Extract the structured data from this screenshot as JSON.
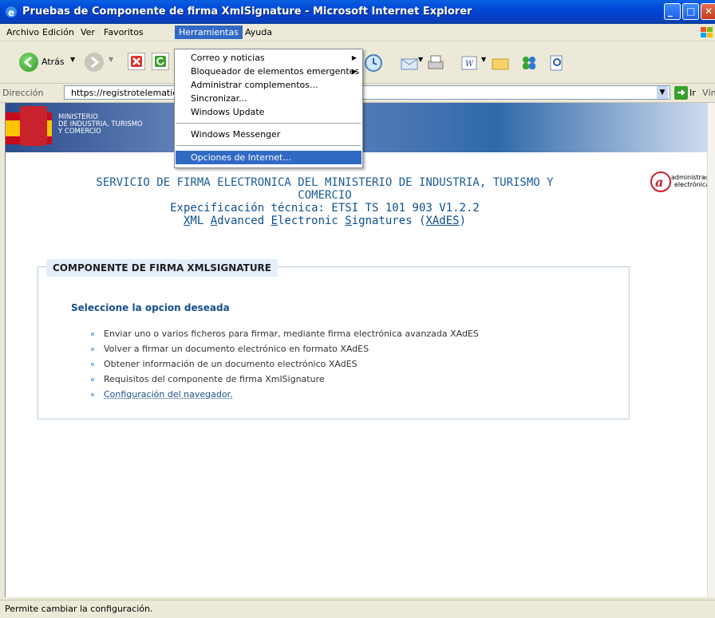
{
  "window": {
    "title": "Pruebas de Componente de firma XmlSignature - Microsoft Internet Explorer"
  },
  "menubar": {
    "items": [
      "Archivo",
      "Edición",
      "Ver",
      "Favoritos",
      "Herramientas",
      "Ayuda"
    ],
    "active": "Herramientas"
  },
  "toolbar": {
    "back_label": "Atrás"
  },
  "address": {
    "label": "Dirección",
    "value": "https://registrotelematico",
    "go_label": "Ir",
    "links_label": "Vínculos"
  },
  "dropdown": {
    "items": [
      "Correo y noticias",
      "Bloqueador de elementos emergentes",
      "Administrar complementos...",
      "Sincronizar...",
      "Windows Update",
      "Windows Messenger",
      "Opciones de Internet..."
    ],
    "highlighted": "Opciones de Internet..."
  },
  "banner": {
    "ministry_lines": [
      "MINISTERIO",
      "DE INDUSTRIA, TURISMO",
      "Y COMERCIO"
    ]
  },
  "header": {
    "line1": "SERVICIO DE FIRMA ELECTRONICA DEL MINISTERIO DE INDUSTRIA, TURISMO Y",
    "line2": "COMERCIO",
    "line3": "Expecificación técnica: ETSI TS 101 903 V1.2.2",
    "line4_parts": [
      "X",
      "ML ",
      "A",
      "dvanced ",
      "E",
      "lectronic ",
      "S",
      "ignatures (",
      "XAdES",
      ")"
    ]
  },
  "logo": {
    "line1": "administración",
    "line2": "electrónica"
  },
  "panel": {
    "title": "COMPONENTE DE FIRMA XMLSIGNATURE",
    "subtitle": "Seleccione la opcion deseada",
    "options": [
      "Enviar uno o varios ficheros para firmar, mediante firma electrónica avanzada XAdES",
      "Volver a firmar un documento electrónico en formato XAdES",
      "Obtener información de un documento electrónico XAdES",
      "Requisitos del componente de firma XmlSignature",
      "Configuración del navegador."
    ]
  },
  "status": {
    "text": "Permite cambiar la configuración."
  }
}
